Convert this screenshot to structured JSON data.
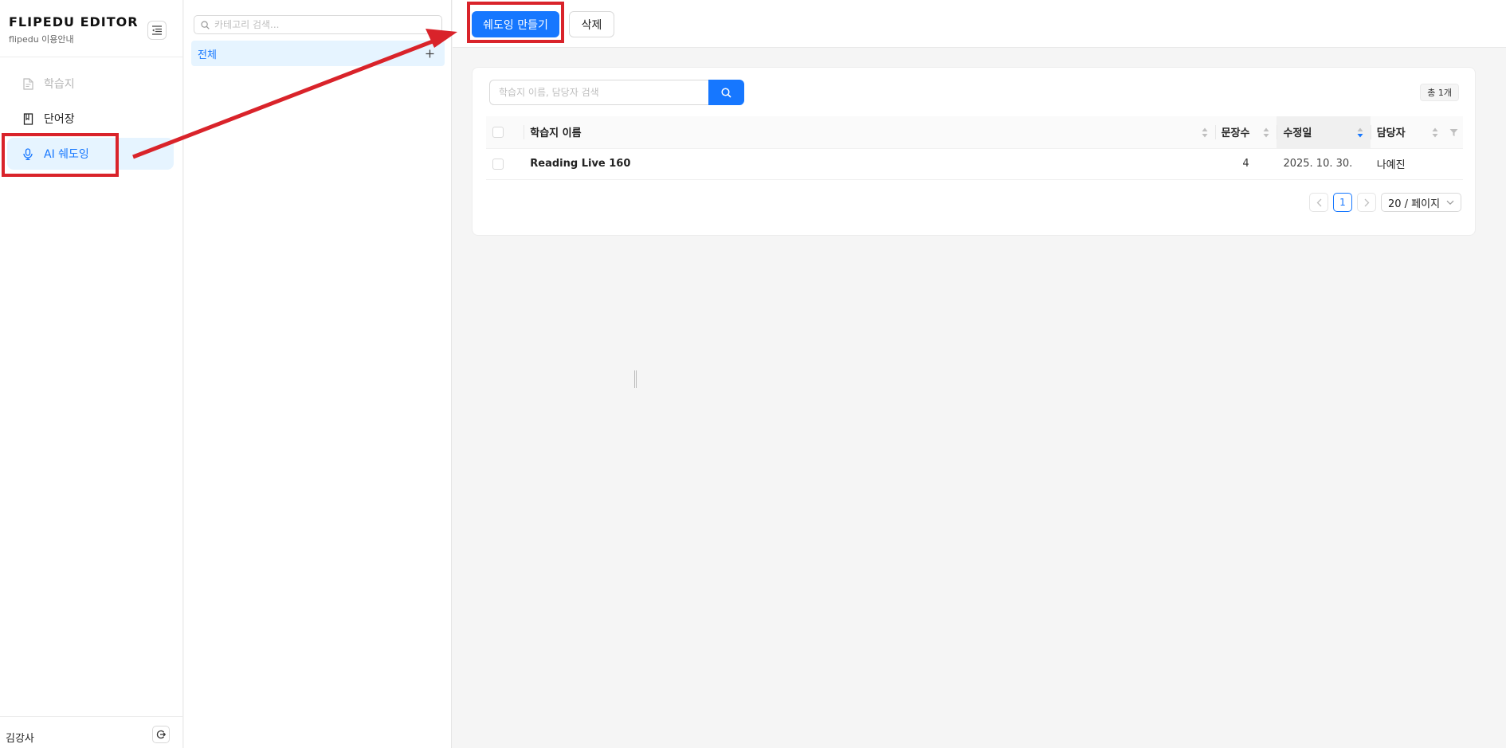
{
  "brand": {
    "title": "FLIPEDU EDITOR",
    "subtitle": "flipedu 이용안내"
  },
  "sidebar": {
    "items": [
      {
        "label": "학습지",
        "icon": "document-icon",
        "state": "disabled"
      },
      {
        "label": "단어장",
        "icon": "book-icon",
        "state": "normal"
      },
      {
        "label": "AI 쉐도잉",
        "icon": "microphone-icon",
        "state": "active"
      }
    ],
    "footer": {
      "user": "김강사",
      "logout_icon": "logout-icon"
    }
  },
  "category": {
    "search_placeholder": "카테고리 검색...",
    "items": [
      {
        "label": "전체"
      }
    ]
  },
  "toolbar": {
    "create_label": "쉐도잉 만들기",
    "delete_label": "삭제"
  },
  "list": {
    "search_placeholder": "학습지 이름, 담당자 검색",
    "total_label": "총 1개",
    "columns": {
      "name": "학습지 이름",
      "sentences": "문장수",
      "modified": "수정일",
      "owner": "담당자"
    },
    "rows": [
      {
        "name": "Reading Live 160",
        "sentences": "4",
        "modified": "2025. 10. 30.",
        "owner": "나예진"
      }
    ],
    "pagination": {
      "current": "1",
      "page_size": "20 / 페이지"
    }
  },
  "colors": {
    "accent": "#1677ff",
    "annotation": "#d9232a"
  }
}
